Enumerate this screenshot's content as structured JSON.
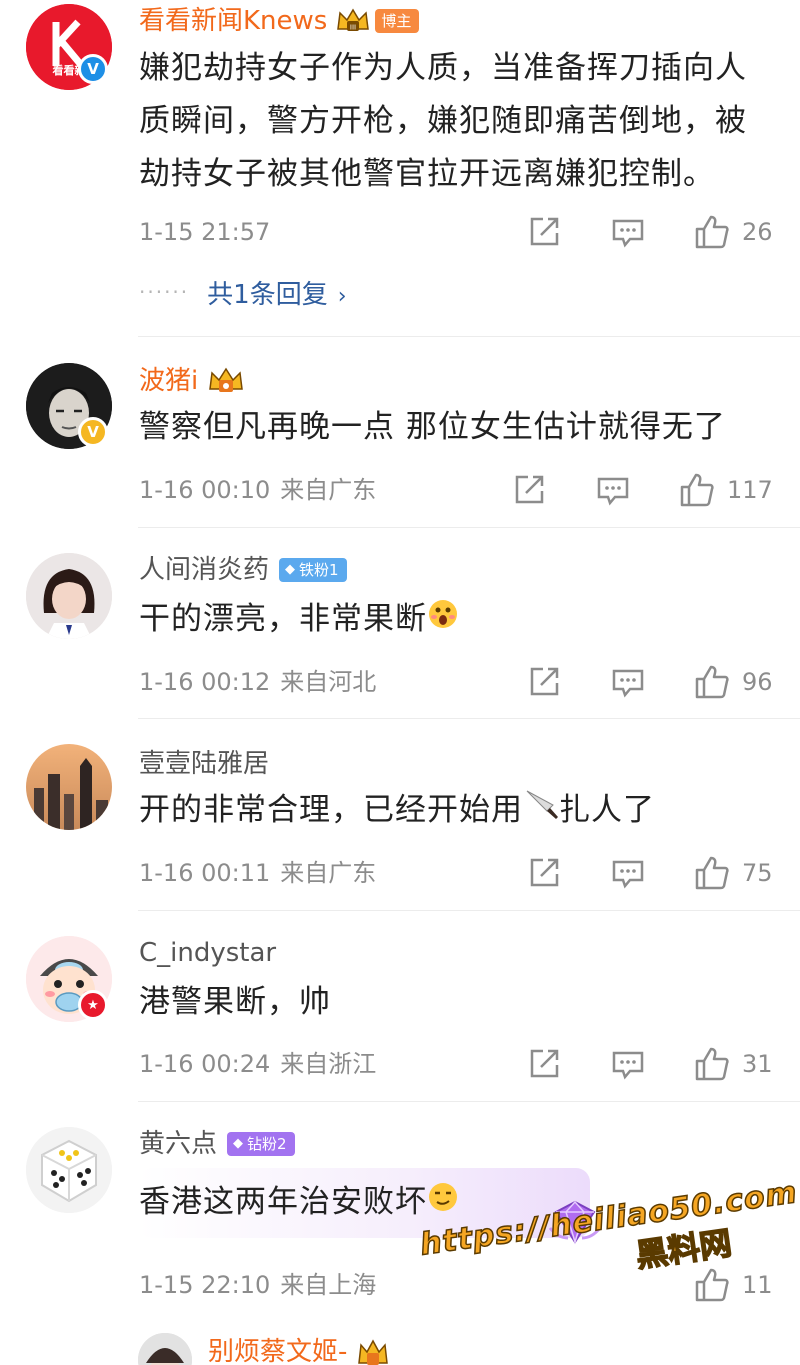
{
  "comments": [
    {
      "username": "看看新闻Knews",
      "tag": "博主",
      "text": "嫌犯劫持女子作为人质，当准备挥刀插向人质瞬间，警方开枪，嫌犯随即痛苦倒地，被劫持女子被其他警官拉开远离嫌犯控制。",
      "time": "1-15 21:57",
      "location": "",
      "likes": "26",
      "avatar_text": "看看新",
      "reply_dots": "······",
      "reply_link": "共1条回复",
      "reply_chevron": "›"
    },
    {
      "username": "波猪i",
      "text": "警察但凡再晚一点 那位女生估计就得无了",
      "time": "1-16 00:10",
      "location": "来自广东",
      "likes": "117"
    },
    {
      "username": "人间消炎药",
      "tag": "铁粉1",
      "text": "干的漂亮，非常果断",
      "time": "1-16 00:12",
      "location": "来自河北",
      "likes": "96"
    },
    {
      "username": "壹壹陆雅居",
      "text_before": "开的非常合理，已经开始用",
      "text_after": "扎人了",
      "time": "1-16 00:11",
      "location": "来自广东",
      "likes": "75"
    },
    {
      "username": "C_indystar",
      "text": "港警果断，帅",
      "time": "1-16 00:24",
      "location": "来自浙江",
      "likes": "31"
    },
    {
      "username": "黄六点",
      "tag": "钻粉2",
      "text": "香港这两年治安败坏",
      "time": "1-15 22:10",
      "location": "来自上海",
      "likes": "11"
    },
    {
      "username": "别烦蔡文姬-"
    }
  ],
  "watermark": {
    "url": "https://heiliao50.com",
    "name": "黑料网"
  },
  "colors": {
    "username_vip": "#f2691b",
    "reply_link": "#2f5d9e",
    "meta": "#8c8c8c"
  }
}
